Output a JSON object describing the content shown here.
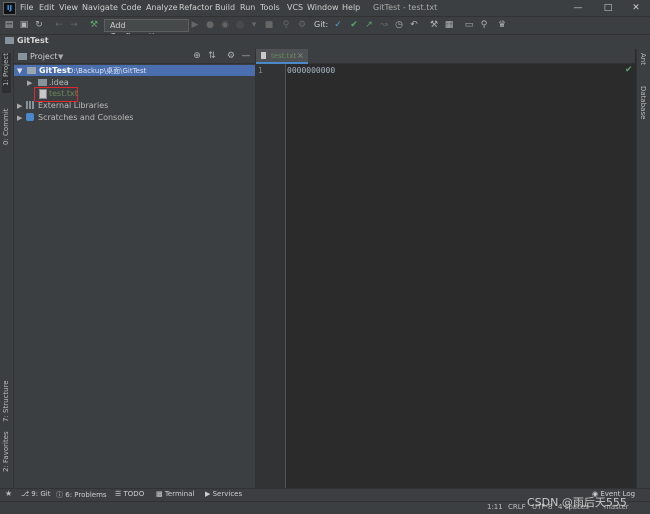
{
  "app": {
    "logo": "IJ",
    "window_title": "GitTest - test.txt"
  },
  "menu": [
    "File",
    "Edit",
    "View",
    "Navigate",
    "Code",
    "Analyze",
    "Refactor",
    "Build",
    "Run",
    "Tools",
    "VCS",
    "Window",
    "Help"
  ],
  "toolbar": {
    "run_config": "Add Configuration...",
    "git_label": "Git:"
  },
  "navbar": {
    "project": "GitTest"
  },
  "left_tabs": {
    "project": "1: Project",
    "commit": "0: Commit",
    "structure": "7: Structure",
    "favorites": "2: Favorites"
  },
  "right_tabs": {
    "ant": "Ant",
    "database": "Database"
  },
  "project_panel": {
    "title": "Project"
  },
  "tree": {
    "root_name": "GitTest",
    "root_path": "D:\\Backup\\桌面\\GitTest",
    "idea": ".idea",
    "file": "test.txt",
    "external": "External Libraries",
    "scratches": "Scratches and Consoles"
  },
  "editor": {
    "tab": "test.txt",
    "line_number": "1",
    "content": "0000000000"
  },
  "bottom_tabs": [
    "9: Git",
    "6: Problems",
    "TODO",
    "Terminal",
    "Services"
  ],
  "event_log": "Event Log",
  "status": {
    "position": "1:11",
    "line_sep": "CRLF",
    "encoding": "UTF-8",
    "indent": "4 spaces",
    "branch": "master"
  },
  "watermark": "CSDN @雨后天555",
  "colors": {
    "accent": "#4b6eaf",
    "check": "#59a869",
    "highlight_box": "#e0262a"
  }
}
